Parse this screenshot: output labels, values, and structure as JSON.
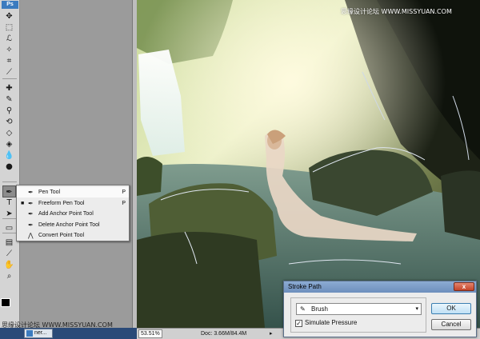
{
  "app": {
    "logo": "Ps"
  },
  "toolbox": {
    "tools": [
      {
        "name": "move-tool-icon",
        "glyph": "✥"
      },
      {
        "name": "marquee-tool-icon",
        "glyph": "⬚"
      },
      {
        "name": "lasso-tool-icon",
        "glyph": "ℒ"
      },
      {
        "name": "magic-wand-tool-icon",
        "glyph": "✧"
      },
      {
        "name": "crop-tool-icon",
        "glyph": "⌗"
      },
      {
        "name": "eyedropper-tool-icon",
        "glyph": "⟋"
      },
      {
        "name": "healing-brush-tool-icon",
        "glyph": "✚"
      },
      {
        "name": "brush-tool-icon",
        "glyph": "✎"
      },
      {
        "name": "clone-stamp-tool-icon",
        "glyph": "⚲"
      },
      {
        "name": "history-brush-tool-icon",
        "glyph": "⟲"
      },
      {
        "name": "eraser-tool-icon",
        "glyph": "◇"
      },
      {
        "name": "paint-bucket-tool-icon",
        "glyph": "◈"
      },
      {
        "name": "blur-tool-icon",
        "glyph": "💧"
      },
      {
        "name": "dodge-tool-icon",
        "glyph": "●"
      },
      {
        "name": "pen-tool-icon",
        "glyph": "✒"
      },
      {
        "name": "type-tool-icon",
        "glyph": "T"
      },
      {
        "name": "path-selection-tool-icon",
        "glyph": "➤"
      },
      {
        "name": "shape-tool-icon",
        "glyph": "▭"
      },
      {
        "name": "notes-tool-icon",
        "glyph": "▤"
      },
      {
        "name": "eyedropper2-tool-icon",
        "glyph": "⟋"
      },
      {
        "name": "hand-tool-icon",
        "glyph": "✋"
      },
      {
        "name": "zoom-tool-icon",
        "glyph": "⌕"
      }
    ]
  },
  "flyout": {
    "items": [
      {
        "label": "Pen Tool",
        "shortcut": "P",
        "active": false
      },
      {
        "label": "Freeform Pen Tool",
        "shortcut": "P",
        "active": true
      },
      {
        "label": "Add Anchor Point Tool",
        "shortcut": "",
        "active": false
      },
      {
        "label": "Delete Anchor Point Tool",
        "shortcut": "",
        "active": false
      },
      {
        "label": "Convert Point Tool",
        "shortcut": "",
        "active": false
      }
    ],
    "bullet": "■"
  },
  "watermark": {
    "top": "思缘设计论坛 WWW.MISSYUAN.COM",
    "bottom": "思缘设计论坛 WWW.MISSYUAN.COM"
  },
  "statusbar": {
    "zoom": "53.51%",
    "doc": "Doc: 3.66M/84.4M",
    "arrow": "▸"
  },
  "taskbar": {
    "button": "ner..."
  },
  "dialog": {
    "title": "Stroke Path",
    "close": "x",
    "tool_value": "Brush",
    "simulate_label": "Simulate Pressure",
    "simulate_checked": true,
    "check_mark": "✓",
    "ok": "OK",
    "cancel": "Cancel",
    "dropdown_arrow": "▾"
  }
}
